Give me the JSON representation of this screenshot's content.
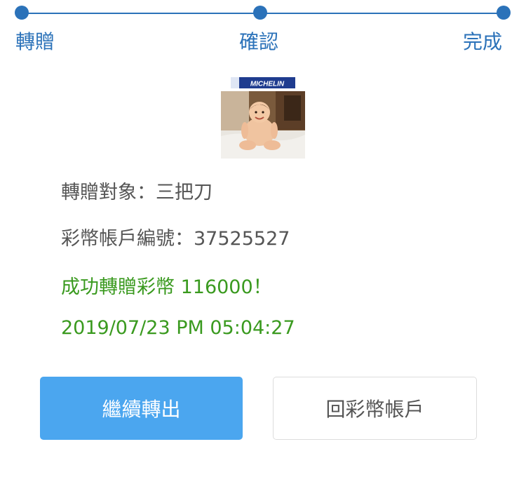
{
  "stepper": {
    "steps": [
      {
        "label": "轉贈"
      },
      {
        "label": "確認"
      },
      {
        "label": "完成"
      }
    ],
    "color": "#2b72b9"
  },
  "avatar": {
    "logo_text": "MICHELIN"
  },
  "info": {
    "recipient": "轉贈對象：三把刀",
    "account": "彩幣帳戶編號：37525527",
    "success_message": "成功轉贈彩幣 116000！",
    "timestamp": "2019/07/23 PM 05:04:27"
  },
  "buttons": {
    "continue_label": "繼續轉出",
    "back_label": "回彩幣帳戶",
    "primary_color": "#4ba6ef"
  }
}
